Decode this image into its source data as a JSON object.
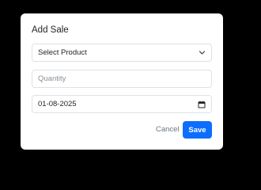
{
  "modal": {
    "title": "Add Sale",
    "product_select": {
      "selected": "Select Product",
      "icon": "chevron-down-icon"
    },
    "quantity_input": {
      "value": "",
      "placeholder": "Quantity"
    },
    "date_input": {
      "value": "01-08-2025",
      "icon": "calendar-icon"
    },
    "cancel_label": "Cancel",
    "save_label": "Save"
  },
  "colors": {
    "backdrop": "#000000",
    "modal_background": "#ffffff",
    "primary": "#0d6efd",
    "muted_text": "#6c757d",
    "border": "#dee2e6"
  }
}
